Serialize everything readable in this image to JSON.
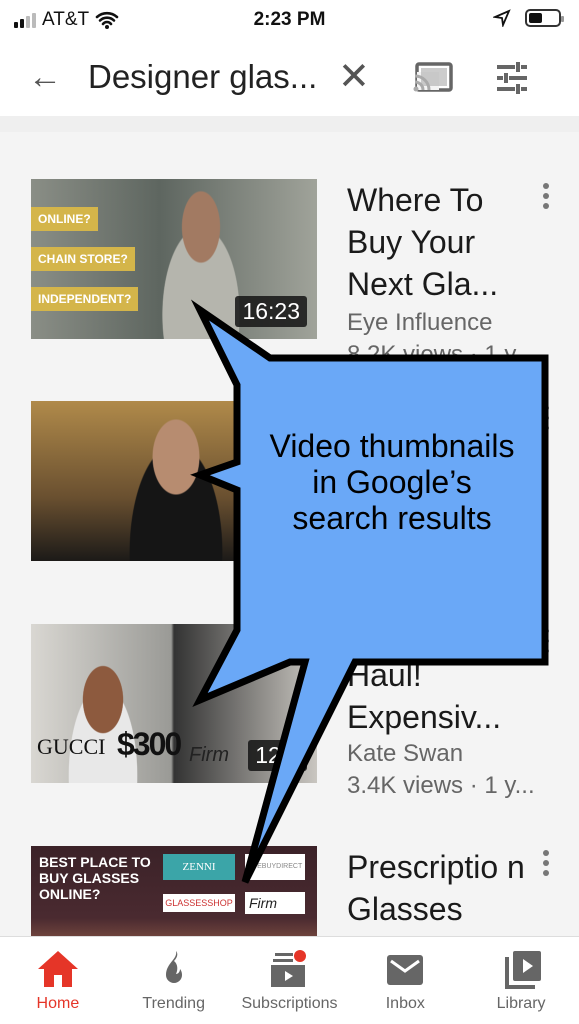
{
  "status_bar": {
    "carrier": "AT&T",
    "time": "2:23 PM"
  },
  "search": {
    "query": "Designer glas...",
    "back_icon": "arrow-left-icon",
    "clear_icon": "close-icon",
    "cast_icon": "cast-icon",
    "filter_icon": "filter-sliders-icon"
  },
  "results": [
    {
      "title": "Where To Buy Your Next Gla...",
      "channel": "Eye Influence",
      "stats": "8.2K views · 1 y...",
      "duration": "16:23",
      "thumb_labels": [
        "ONLINE?",
        "CHAIN STORE?",
        "INDEPENDENT?"
      ]
    },
    {
      "title": "",
      "channel": "",
      "stats": "",
      "duration": "",
      "thumb_labels": []
    },
    {
      "title_partial": "Haul!",
      "title": "Expensiv...",
      "channel": "Kate Swan",
      "stats": "3.4K views · 1 y...",
      "duration": "12:3",
      "thumb_labels": [
        "GUCCI",
        "$300",
        "Firm"
      ]
    },
    {
      "title": "Prescriptio n Glasses Websites",
      "channel": "",
      "stats": "",
      "duration": "",
      "thumb_labels": [
        "BEST PLACE TO BUY GLASSES ONLINE?",
        "ZENNI",
        "EYEBUYDIRECT",
        "GLASSESSHOP",
        "Firm"
      ]
    }
  ],
  "nav": [
    {
      "label": "Home",
      "icon": "home-icon",
      "active": true
    },
    {
      "label": "Trending",
      "icon": "flame-icon"
    },
    {
      "label": "Subscriptions",
      "icon": "subscriptions-icon"
    },
    {
      "label": "Inbox",
      "icon": "mail-icon"
    },
    {
      "label": "Library",
      "icon": "library-icon"
    }
  ],
  "callout": {
    "text": "Video thumbnails in Google’s search results",
    "fill": "#6aa8f7"
  },
  "colors": {
    "accent": "#e53528",
    "notification": "#e53528"
  }
}
